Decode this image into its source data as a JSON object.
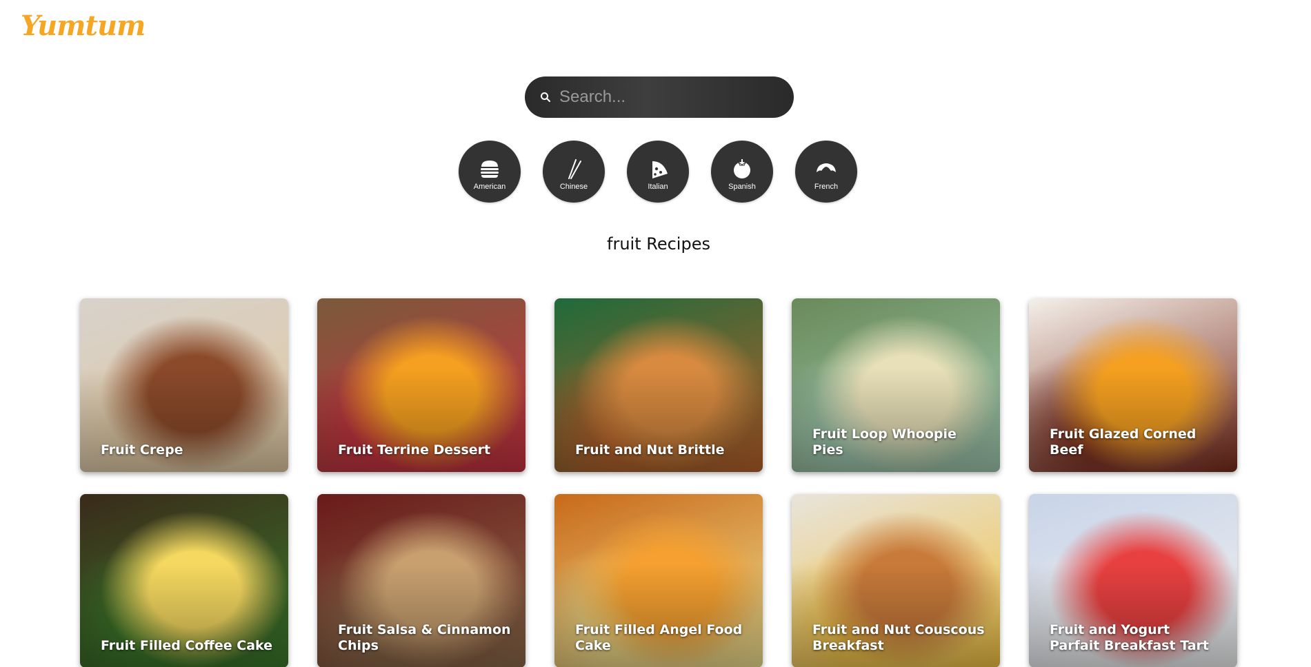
{
  "brand": {
    "logo_text": "Yumtum",
    "accent_color": "#f5a623"
  },
  "search": {
    "placeholder": "Search...",
    "value": "",
    "icon": "search-icon"
  },
  "cuisines": [
    {
      "label": "American",
      "icon": "burger-icon"
    },
    {
      "label": "Chinese",
      "icon": "chopsticks-icon"
    },
    {
      "label": "Italian",
      "icon": "pizza-icon"
    },
    {
      "label": "Spanish",
      "icon": "tomato-icon"
    },
    {
      "label": "French",
      "icon": "croissant-icon"
    }
  ],
  "section": {
    "title": "fruit Recipes"
  },
  "recipes": [
    {
      "title": "Fruit Crepe",
      "colors": [
        "#d8d2cc",
        "#8b4a2a",
        "#e0c8a0"
      ]
    },
    {
      "title": "Fruit Terrine Dessert",
      "colors": [
        "#7a5a3a",
        "#f5a020",
        "#c83040"
      ]
    },
    {
      "title": "Fruit and Nut Brittle",
      "colors": [
        "#1f6a3a",
        "#d88a40",
        "#b8602a"
      ]
    },
    {
      "title": "Fruit Loop Whoopie Pies",
      "colors": [
        "#6a8a5a",
        "#e8e0b8",
        "#a0c8b0"
      ]
    },
    {
      "title": "Fruit Glazed Corned Beef",
      "colors": [
        "#f4f0ea",
        "#f5a020",
        "#7a2a1a"
      ]
    },
    {
      "title": "Fruit Filled Coffee Cake",
      "colors": [
        "#3a2a1a",
        "#f5d860",
        "#3a7a2a"
      ]
    },
    {
      "title": "Fruit Salsa & Cinnamon Chips",
      "colors": [
        "#6a1a1a",
        "#c8a070",
        "#8a6a4a"
      ]
    },
    {
      "title": "Fruit Filled Angel Food Cake",
      "colors": [
        "#c86a1a",
        "#f5a030",
        "#f0e090"
      ]
    },
    {
      "title": "Fruit and Nut Couscous Breakfast",
      "colors": [
        "#e8e4dc",
        "#c87a3a",
        "#f0c040"
      ]
    },
    {
      "title": "Fruit and Yogurt Parfait Breakfast Tart",
      "colors": [
        "#c8d4e8",
        "#e84040",
        "#f0f0f0"
      ]
    }
  ]
}
